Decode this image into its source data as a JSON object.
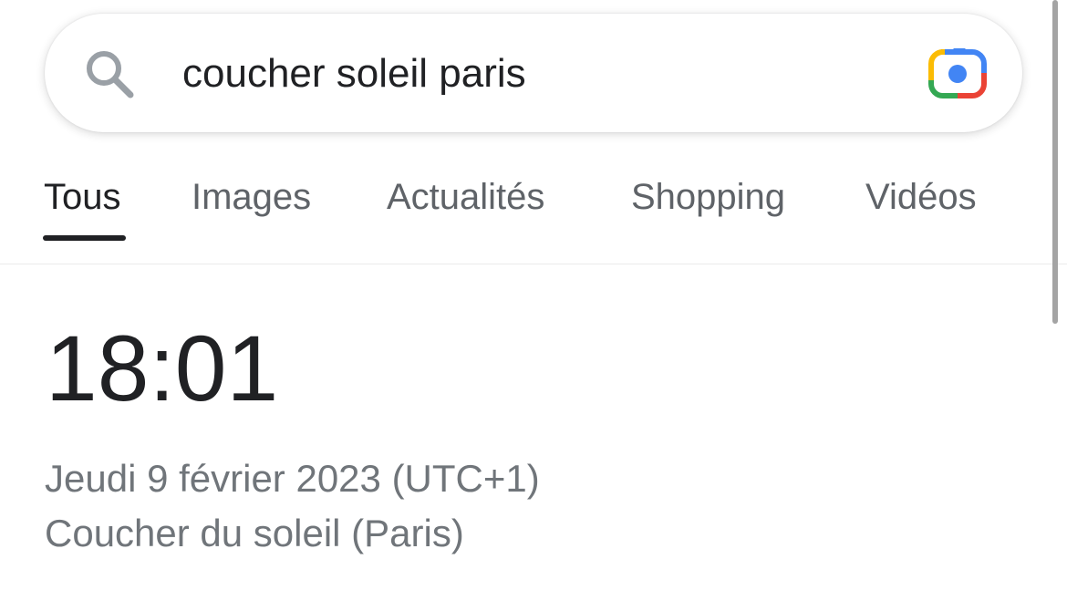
{
  "search": {
    "query": "coucher soleil paris",
    "search_icon": "search-icon",
    "lens_icon": "google-lens-camera-icon"
  },
  "tabs": [
    {
      "label": "Tous",
      "active": true
    },
    {
      "label": "Images",
      "active": false
    },
    {
      "label": "Actualités",
      "active": false
    },
    {
      "label": "Shopping",
      "active": false
    },
    {
      "label": "Vidéos",
      "active": false
    }
  ],
  "answer": {
    "time": "18:01",
    "date": "Jeudi 9 février 2023 (UTC+1)",
    "label": "Coucher du soleil (Paris)"
  },
  "colors": {
    "text_primary": "#202124",
    "text_secondary": "#70757a",
    "tab_inactive": "#5f6368",
    "lens_blue": "#4285f4",
    "lens_red": "#ea4335",
    "lens_yellow": "#fbbc04",
    "lens_green": "#34a853"
  }
}
